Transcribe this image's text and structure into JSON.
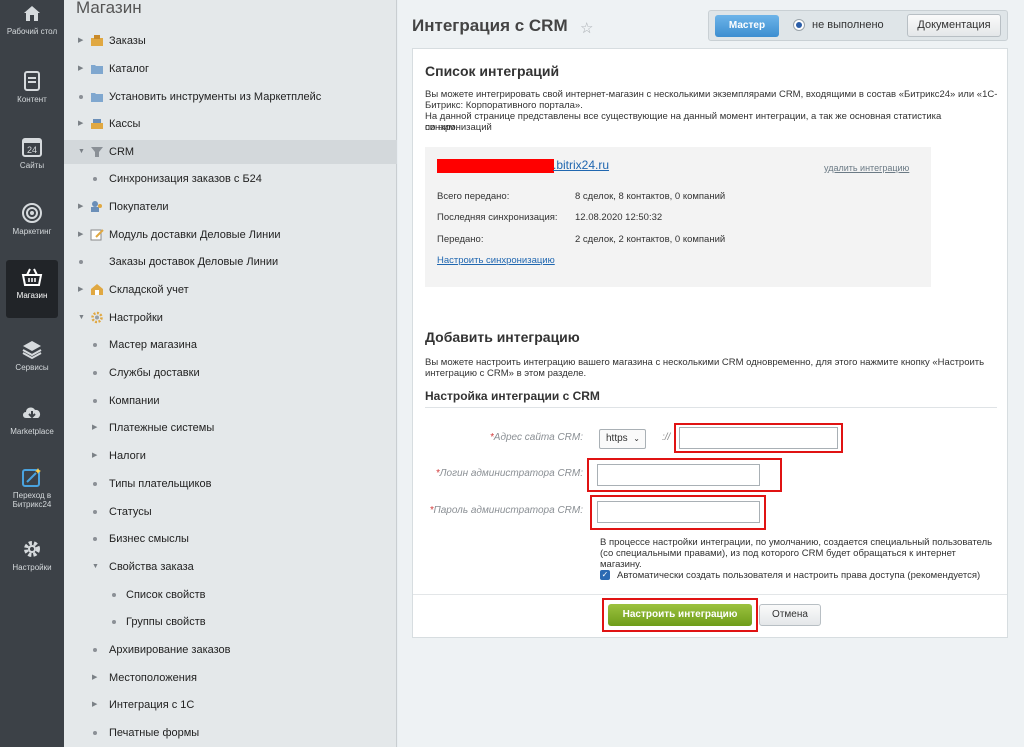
{
  "rail": [
    {
      "label": "Рабочий стол",
      "icon": "home-icon"
    },
    {
      "label": "Контент",
      "icon": "document-icon"
    },
    {
      "label": "Сайты",
      "icon": "calendar-icon"
    },
    {
      "label": "Маркетинг",
      "icon": "target-icon"
    },
    {
      "label": "Магазин",
      "icon": "basket-icon"
    },
    {
      "label": "Сервисы",
      "icon": "layers-icon"
    },
    {
      "label": "Marketplace",
      "icon": "cloud-download-icon"
    },
    {
      "label": "Переход в Битрикс24",
      "icon": "magic-wand-icon"
    },
    {
      "label": "Настройки",
      "icon": "gear-icon"
    }
  ],
  "sidebar": {
    "title": "Магазин",
    "items": [
      {
        "label": "Заказы"
      },
      {
        "label": "Каталог"
      },
      {
        "label": "Установить инструменты из Маркетплейс"
      },
      {
        "label": "Кассы"
      },
      {
        "label": "CRM"
      },
      {
        "label": "Синхронизация заказов с Б24"
      },
      {
        "label": "Покупатели"
      },
      {
        "label": "Модуль доставки Деловые Линии"
      },
      {
        "label": "Заказы доставок Деловые Линии"
      },
      {
        "label": "Складской учет"
      },
      {
        "label": "Настройки"
      },
      {
        "label": "Мастер магазина"
      },
      {
        "label": "Службы доставки"
      },
      {
        "label": "Компании"
      },
      {
        "label": "Платежные системы"
      },
      {
        "label": "Налоги"
      },
      {
        "label": "Типы плательщиков"
      },
      {
        "label": "Статусы"
      },
      {
        "label": "Бизнес смыслы"
      },
      {
        "label": "Свойства заказа"
      },
      {
        "label": "Список свойств"
      },
      {
        "label": "Группы свойств"
      },
      {
        "label": "Архивирование заказов"
      },
      {
        "label": "Местоположения"
      },
      {
        "label": "Интеграция с 1С"
      },
      {
        "label": "Печатные формы"
      }
    ]
  },
  "header": {
    "title": "Интеграция с CRM",
    "master_label": "Мастер",
    "status_label": "не выполнено",
    "docs_label": "Документация"
  },
  "list_section": {
    "title": "Список интеграций",
    "desc_1": "Вы можете интегрировать свой интернет-магазин с несколькими экземплярами CRM, входящими в состав «Битрикс24» или «1С-",
    "desc_2": "Битрикс: Корпоративного портала».",
    "desc_3": "На данной странице представлены все существующие на данный момент интеграции, а так же основная статистика синхронизаций",
    "desc_4": "по ним.",
    "integration": {
      "domain": ".bitrix24.ru",
      "delete_label": "удалить интеграцию",
      "total_label": "Всего передано:",
      "total_value": "8 сделок, 8 контактов, 0 компаний",
      "last_sync_label": "Последняя синхронизация:",
      "last_sync_value": "12.08.2020 12:50:32",
      "sent_label": "Передано:",
      "sent_value": "2 сделок, 2 контактов, 0 компаний",
      "setup_link": "Настроить синхронизацию"
    }
  },
  "add_section": {
    "title": "Добавить интеграцию",
    "desc_1": "Вы можете настроить интеграцию вашего магазина с несколькими CRM одновременно, для этого нажмите кнопку «Настроить",
    "desc_2": "интеграцию с CRM» в этом разделе.",
    "subtitle": "Настройка интеграции с CRM",
    "req": "*",
    "address_label": "Адрес сайта CRM:",
    "protocol": "https",
    "slashes": "://",
    "login_label": "Логин администратора CRM:",
    "password_label": "Пароль администратора CRM:",
    "note_1": "В процессе настройки интеграции, по умолчанию, создается специальный пользователь",
    "note_2": "(со специальными правами), из под которого CRM будет обращаться к интернет магазину.",
    "checkbox_label": "Автоматически создать пользователя и настроить права доступа (рекомендуется)",
    "checkbox_checked": true,
    "submit_label": "Настроить интеграцию",
    "cancel_label": "Отмена"
  },
  "colors": {
    "accent_green": "#7ba82a",
    "highlight_red": "#e01313",
    "link_blue": "#2067b0"
  }
}
